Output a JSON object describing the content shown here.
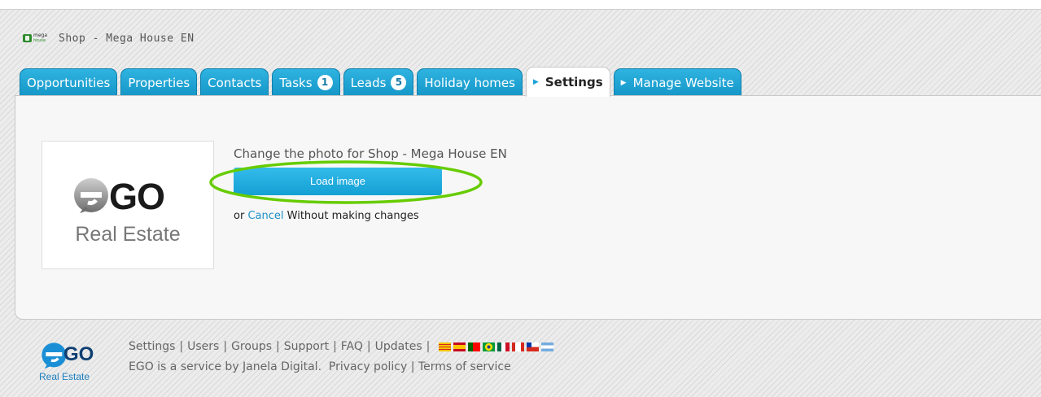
{
  "header": {
    "logo_top": "mega",
    "logo_bottom": "house",
    "shop_title": "Shop - Mega House EN"
  },
  "tabs": [
    {
      "label": "Opportunities",
      "count": null,
      "arrow": false,
      "active": false
    },
    {
      "label": "Properties",
      "count": null,
      "arrow": false,
      "active": false
    },
    {
      "label": "Contacts",
      "count": null,
      "arrow": false,
      "active": false
    },
    {
      "label": "Tasks",
      "count": "1",
      "arrow": false,
      "active": false
    },
    {
      "label": "Leads",
      "count": "5",
      "arrow": false,
      "active": false
    },
    {
      "label": "Holiday homes",
      "count": null,
      "arrow": false,
      "active": false
    },
    {
      "label": "Settings",
      "count": null,
      "arrow": true,
      "active": true
    },
    {
      "label": "Manage Website",
      "count": null,
      "arrow": true,
      "active": false
    }
  ],
  "photo": {
    "logo_go": "GO",
    "logo_sub": "Real Estate",
    "change_text": "Change the photo for Shop - Mega House EN",
    "load_button": "Load image",
    "or_text": "or",
    "cancel_link": "Cancel",
    "without_text": "Without making changes",
    "highlight_color": "#66cc00"
  },
  "footer": {
    "logo_go": "GO",
    "logo_sub": "Real Estate",
    "links": [
      "Settings",
      "Users",
      "Groups",
      "Support",
      "FAQ",
      "Updates"
    ],
    "flags": [
      "catalan",
      "spain",
      "portugal",
      "brazil",
      "mexico",
      "canada",
      "chile",
      "argentina"
    ],
    "service_text": "EGO is a service by Janela Digital.",
    "privacy_link": "Privacy policy",
    "terms_link": "Terms of service"
  },
  "colors": {
    "tab_blue": "#1ea7d9",
    "link_blue": "#1c8fc8",
    "brand_navy": "#0f3f72"
  }
}
